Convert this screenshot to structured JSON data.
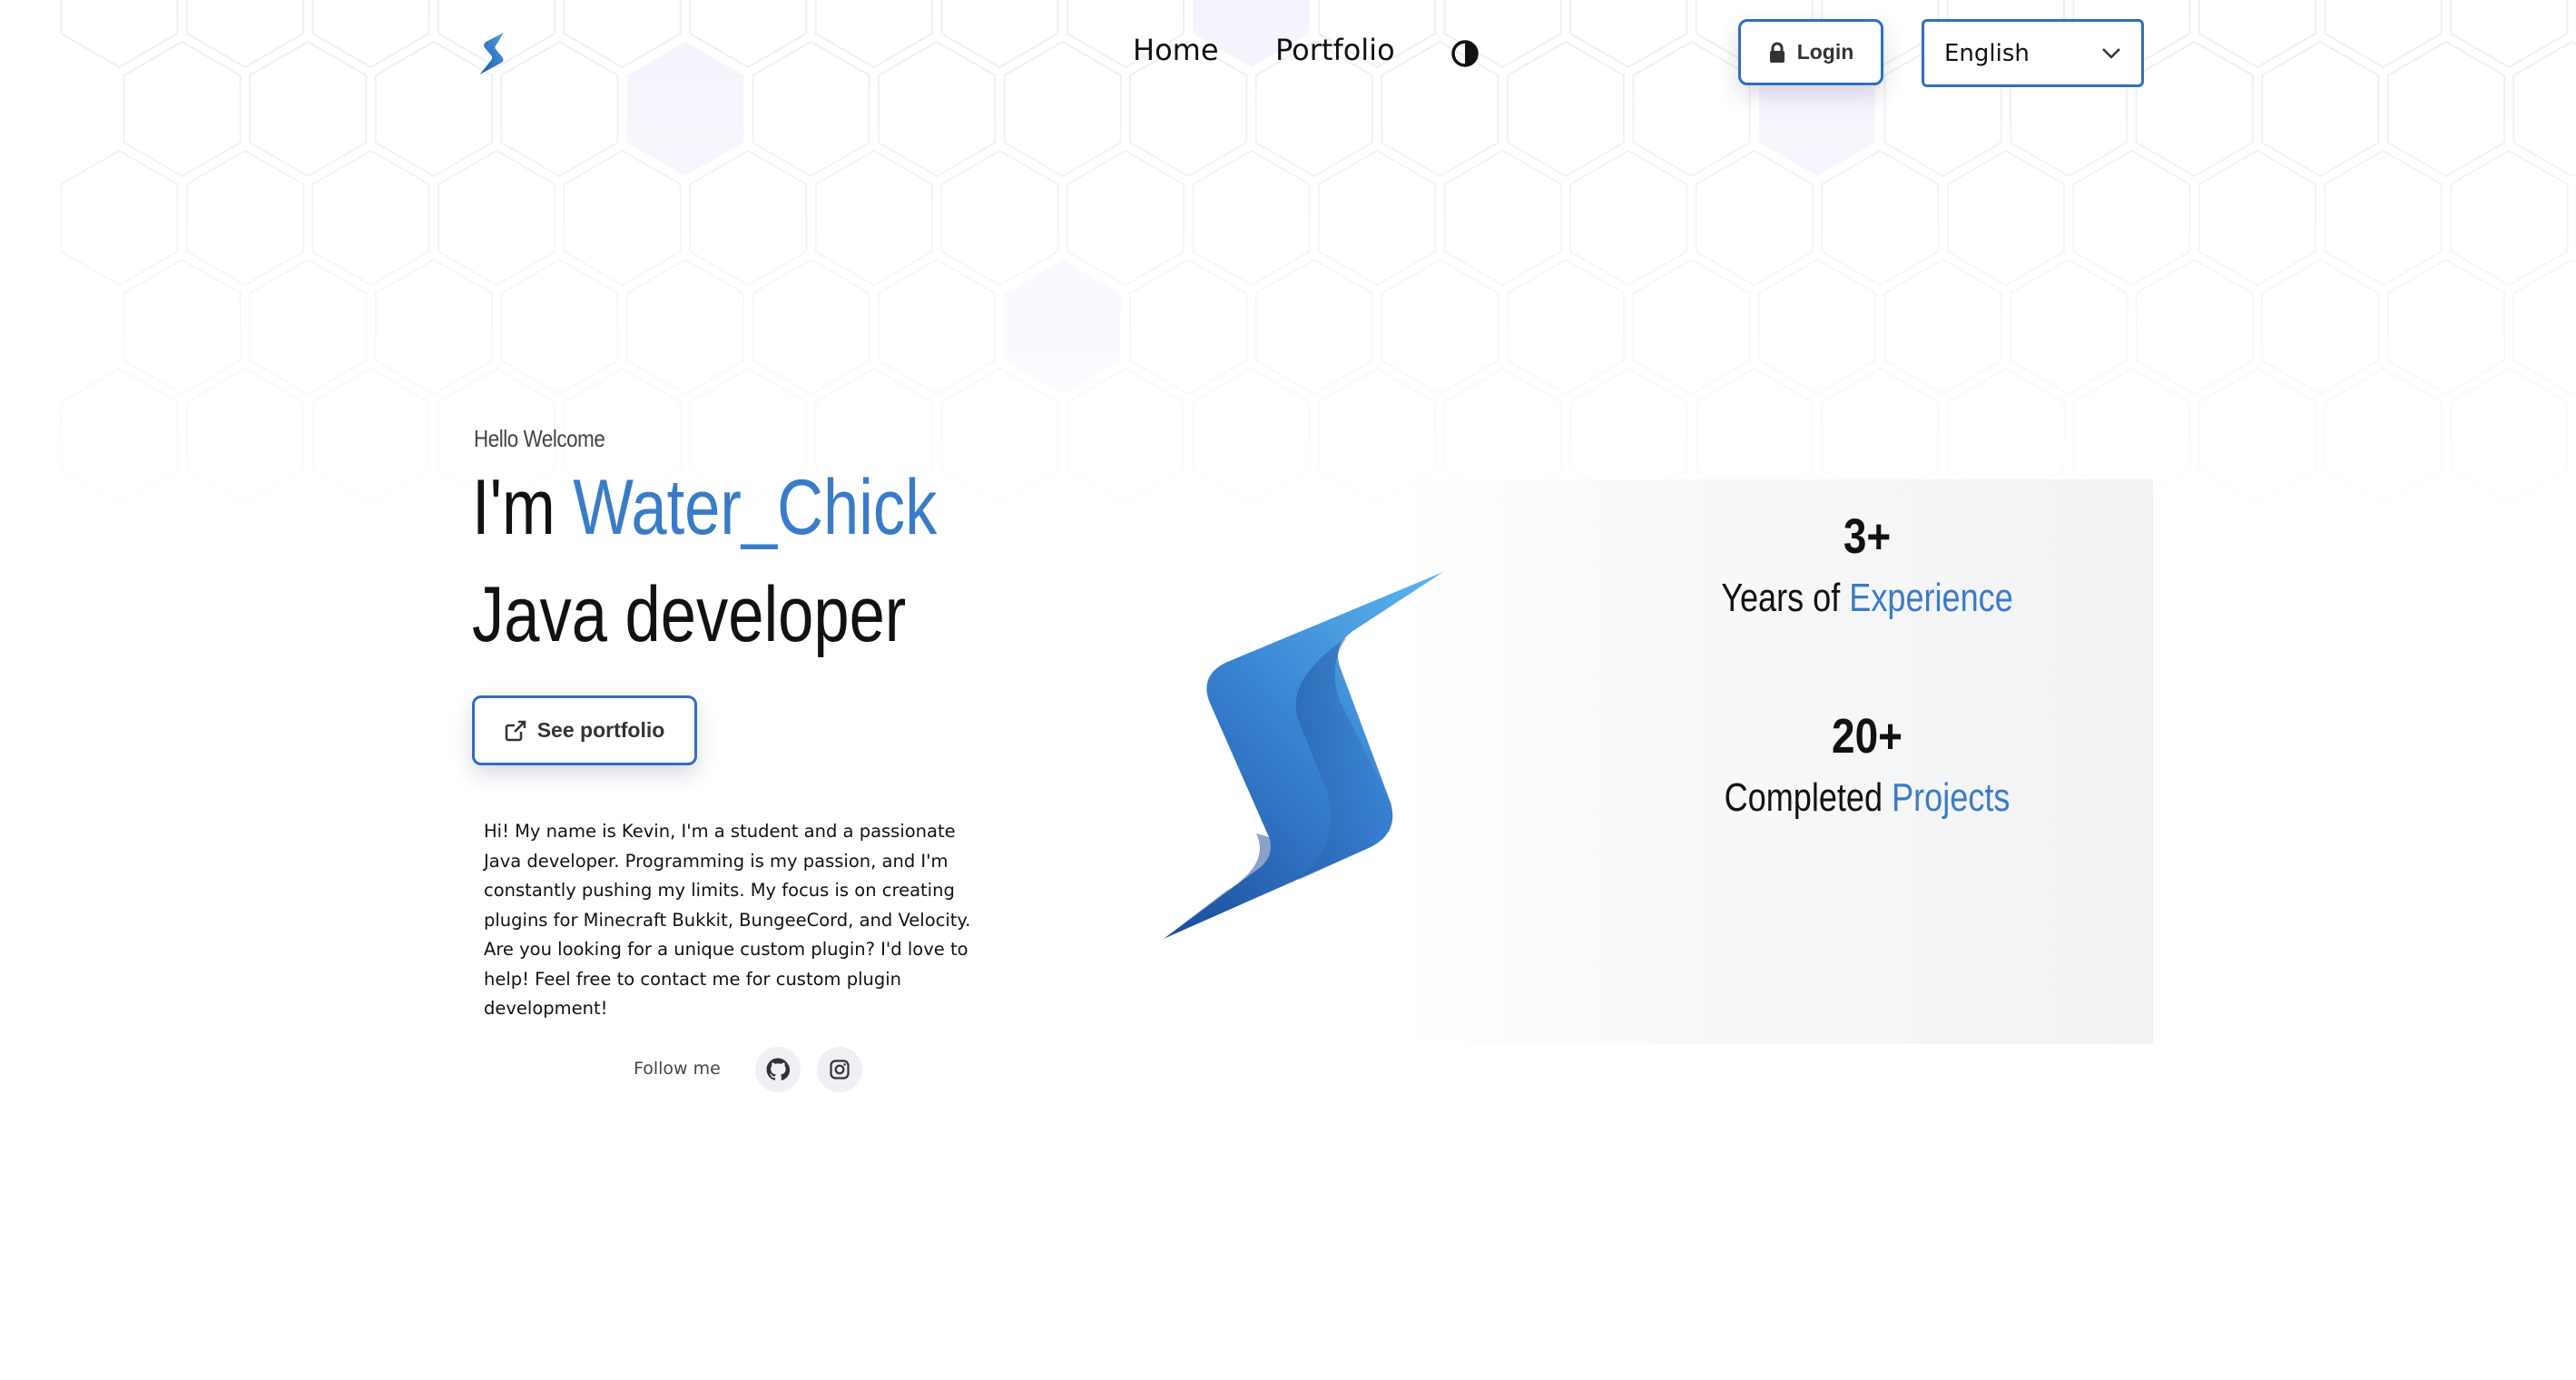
{
  "nav": {
    "home": "Home",
    "portfolio": "Portfolio",
    "theme_icon": "contrast-icon",
    "login_label": "Login",
    "login_icon": "lock-icon",
    "language": {
      "selected": "English",
      "icon": "chevron-down-icon"
    }
  },
  "hero": {
    "greeting": "Hello Welcome",
    "name_prefix": "I'm",
    "name": "Water_Chick",
    "role": "Java developer",
    "portfolio_button": "See portfolio",
    "portfolio_button_icon": "external-link-icon",
    "bio": "Hi! My name is Kevin, I'm a student and a passionate Java developer. Programming is my passion, and I'm constantly pushing my limits. My focus is on creating plugins for Minecraft Bukkit, BungeeCord, and Velocity. Are you looking for a unique custom plugin? I'd love to help! Feel free to contact me for custom plugin development!",
    "follow_label": "Follow me",
    "socials": [
      {
        "icon": "github-icon"
      },
      {
        "icon": "instagram-icon"
      }
    ]
  },
  "stats": [
    {
      "number": "3+",
      "label_plain": "Years of",
      "label_accent": "Experience"
    },
    {
      "number": "20+",
      "label_plain": "Completed",
      "label_accent": "Projects"
    }
  ],
  "colors": {
    "accent": "#3a7bc8",
    "border": "#2f6fbf",
    "text": "#111111"
  }
}
